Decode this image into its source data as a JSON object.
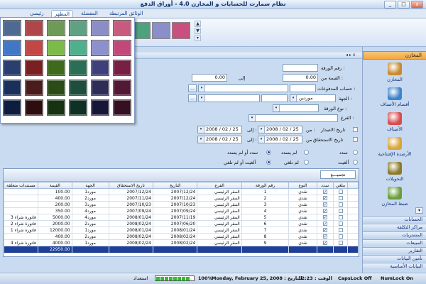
{
  "window": {
    "title": "نظام سمارت للحسابات و المخازن 4.0 - أوراق الدفع",
    "controls": [
      "_",
      "□",
      "x"
    ]
  },
  "tabs": [
    {
      "label": "رئيسي",
      "active": false
    },
    {
      "label": "المظهر",
      "active": true
    },
    {
      "label": "المفضلة",
      "active": false
    },
    {
      "label": "الوثائق المرتبطة",
      "active": false
    }
  ],
  "palette": {
    "colors": [
      "#4f6a92",
      "#b0454a",
      "#6d9a55",
      "#5fa282",
      "#8b8ec6",
      "#c85a80",
      "#4177c6",
      "#c24745",
      "#7dbb48",
      "#4fb08e",
      "#8c90cc",
      "#c2487c",
      "#293f6e",
      "#7a1f22",
      "#3f6a1c",
      "#2a6f55",
      "#3f3f7c",
      "#772044",
      "#19305a",
      "#4a1d1d",
      "#2c4b17",
      "#1f4e3e",
      "#2d2d58",
      "#521936",
      "#0c1d3e",
      "#2d0e10",
      "#163211",
      "#0f3025",
      "#161638",
      "#341022"
    ],
    "ribbon_colors": [
      "#4fa07e",
      "#8a8ecb",
      "#c94f7e"
    ],
    "scroll": [
      "▲",
      "▼",
      "▾"
    ]
  },
  "nav": {
    "header": "المخازن",
    "items": [
      {
        "label": "المخازن",
        "color": "#c98a2d"
      },
      {
        "label": "أقسام الأصناف",
        "color": "#3d84c9"
      },
      {
        "label": "الأصناف",
        "color": "#d64d4d"
      },
      {
        "label": "الأرصدة الإفتتاحية",
        "color": "#d9a63a"
      },
      {
        "label": "التحويلات",
        "color": "#8c7a2a"
      },
      {
        "label": "ضبط المخازن",
        "color": "#6a9e3d"
      }
    ],
    "scroll_glyph": "▾",
    "groups": [
      "الحسابات",
      "مراكز التكلفة",
      "المشتريات",
      "المبيعات",
      "التقارير",
      "تأمين البيانات",
      "البيانات الأساسية"
    ]
  },
  "panel_bar": "◂ ▸ x",
  "form": {
    "paper_no_label": "رقم الورقة :",
    "value_from_label": "القيمة  من :",
    "value_from": "0.00",
    "to_label": "إلى",
    "value_to": "0.00",
    "payments_account_label": "حساب المدفوعات :",
    "party_label": "الجهة :",
    "party_value": "موردين",
    "paper_type_label": "نوع الورقة :",
    "branch_label": "الفرع :",
    "issue_date_label": "تاريخ الاصدار",
    "due_date_label": "تاريخ الاستحقاق",
    "from_label": "من :",
    "to2_label": "إلى :",
    "dates": {
      "issue_from": "2008 / 02 / 25",
      "issue_to": "2008 / 02 / 25",
      "due_from": "2008 / 02 / 25",
      "due_to": "2008 / 02 / 25"
    },
    "dots": "...",
    "radio1": {
      "paid": "سدد",
      "unpaid": "لم يسدد",
      "either": "سدد أو لم يسدد"
    },
    "radio2": {
      "cancelled": "ألغيت",
      "not_cancelled": "لم تلغي",
      "either": "ألغيت أو لم تلغي"
    }
  },
  "grid": {
    "group_button": "تجميـــع",
    "columns": [
      "ملغي",
      "سدد",
      "النوع",
      "رقم الورقة",
      "الفرع",
      "التاريخ",
      "تاريخ الاستحقاق",
      "الجهة",
      "القيمة",
      "مستندات متعلقة"
    ],
    "rows": [
      {
        "cancelled": false,
        "paid": true,
        "type": "نقدي",
        "no": "1",
        "branch": "المقر الرئيسي",
        "date": "2007/12/24",
        "due": "2007/12/24",
        "party": "مورد1",
        "value": "100.00",
        "docs": ""
      },
      {
        "cancelled": false,
        "paid": true,
        "type": "نقدي",
        "no": "2",
        "branch": "المقر الرئيسي",
        "date": "2007/12/24",
        "due": "2007/11/24",
        "party": "مورد2",
        "value": "400.00",
        "docs": ""
      },
      {
        "cancelled": false,
        "paid": true,
        "type": "نقدي",
        "no": "3",
        "branch": "المقر الرئيسي",
        "date": "2007/10/23",
        "due": "2007/10/23",
        "party": "مورد3",
        "value": "200.00",
        "docs": ""
      },
      {
        "cancelled": false,
        "paid": true,
        "type": "نقدي",
        "no": "4",
        "branch": "المقر الرئيسي",
        "date": "2007/09/24",
        "due": "2007/09/24",
        "party": "مورد4",
        "value": "350.00",
        "docs": ""
      },
      {
        "cancelled": false,
        "paid": true,
        "type": "نقدي",
        "no": "5",
        "branch": "المقر الرئيسي",
        "date": "2007/11/19",
        "due": "2008/01/24",
        "party": "مورد4",
        "value": "5000.00",
        "docs": "فاتورة شراء 3"
      },
      {
        "cancelled": false,
        "paid": true,
        "type": "نقدي",
        "no": "6",
        "branch": "المقر الرئيسي",
        "date": "2007/06/20",
        "due": "2008/02/24",
        "party": "مورد2",
        "value": "2000.00",
        "docs": "فاتورة شراء 2"
      },
      {
        "cancelled": false,
        "paid": true,
        "type": "نقدي",
        "no": "7",
        "branch": "المقر الرئيسي",
        "date": "2008/01/24",
        "due": "2008/01/24",
        "party": "مورد1",
        "value": "12000.00",
        "docs": "فاتورة شراء 1"
      },
      {
        "cancelled": false,
        "paid": true,
        "type": "نقدي",
        "no": "8",
        "branch": "المقر الرئيسي",
        "date": "2008/02/24",
        "due": "2008/02/24",
        "party": "مورد2",
        "value": "400.00",
        "docs": ""
      },
      {
        "cancelled": false,
        "paid": true,
        "type": "نقدي",
        "no": "9",
        "branch": "المقر الرئيسي",
        "date": "2008/02/24",
        "due": "2008/02/24",
        "party": "مورد1",
        "value": "4000.00",
        "docs": "فاتورة شراء 4"
      }
    ],
    "total": "22950.00"
  },
  "status": {
    "numlock": "NumLock On",
    "capslock": "CapsLock Off",
    "time": "12:23 : الوقت",
    "date": "Monday, February 25, 2008 : التاريخ",
    "zoom": "100%",
    "ready": "استعداد",
    "progress_blocks": 8
  }
}
